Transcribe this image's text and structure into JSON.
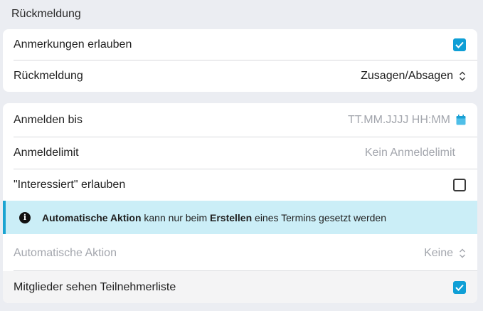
{
  "section": {
    "title": "Rückmeldung"
  },
  "card1": {
    "allow_comments_label": "Anmerkungen erlauben",
    "allow_comments_checked": true,
    "feedback_label": "Rückmeldung",
    "feedback_value": "Zusagen/Absagen"
  },
  "card2": {
    "register_until_label": "Anmelden bis",
    "register_until_placeholder": "TT.MM.JJJJ HH:MM",
    "limit_label": "Anmeldelimit",
    "limit_placeholder": "Kein Anmeldelimit",
    "interested_label": "\"Interessiert\" erlauben",
    "interested_checked": false,
    "info": {
      "part1": "Automatische Aktion",
      "part2": " kann nur beim ",
      "part3": "Erstellen",
      "part4": " eines Termins gesetzt werden"
    },
    "auto_action_label": "Automatische Aktion",
    "auto_action_value": "Keine",
    "members_see_list_label": "Mitglieder sehen Teilnehmerliste",
    "members_see_list_checked": true
  },
  "colors": {
    "accent": "#0f9fd6",
    "info_bg": "#cbeef7",
    "info_border": "#1aa4d1"
  }
}
